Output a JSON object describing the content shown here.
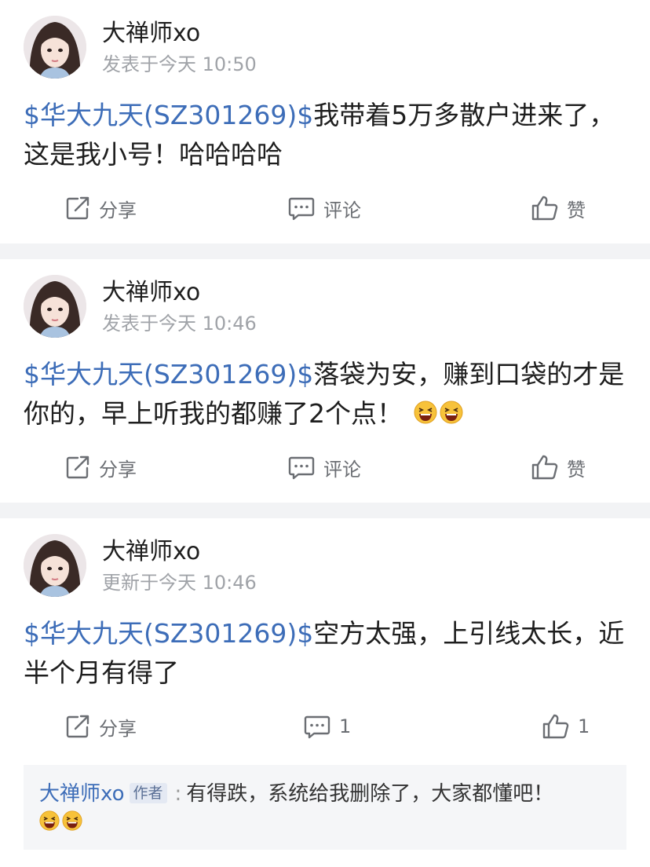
{
  "posts": [
    {
      "author": "大禅师xo",
      "meta": "发表于今天 10:50",
      "stock_tag": "$华大九天(SZ301269)$",
      "text_line1": "我带着5万多散户进来了，",
      "text_line2": "这是我小号！哈哈哈哈",
      "actions": {
        "share": "分享",
        "comment": "评论",
        "like": "赞"
      }
    },
    {
      "author": "大禅师xo",
      "meta": "发表于今天 10:46",
      "stock_tag": "$华大九天(SZ301269)$",
      "text_line1": "落袋为安，赚到口袋的才是",
      "text_line2": "你的，早上听我的都赚了2个点！",
      "emojis": [
        "grinning-squint-emoji",
        "grinning-squint-emoji"
      ],
      "actions": {
        "share": "分享",
        "comment": "评论",
        "like": "赞"
      }
    },
    {
      "author": "大禅师xo",
      "meta": "更新于今天 10:46",
      "stock_tag": "$华大九天(SZ301269)$",
      "text_line1": "空方太强，上引线太长，近",
      "text_line2": "半个月有得了",
      "actions": {
        "share": "分享",
        "comment": "1",
        "like": "1"
      },
      "reply": {
        "author": "大禅师xo",
        "author_tag": "作者",
        "separator": ":",
        "text": "有得跌，系统给我删除了，大家都懂吧！",
        "emojis": [
          "grinning-squint-emoji",
          "grinning-squint-emoji"
        ]
      }
    }
  ],
  "icons": {
    "share": "share-icon",
    "comment": "comment-icon",
    "like": "thumbs-up-icon"
  },
  "colors": {
    "stock_link": "#3d6db8",
    "meta_text": "#a0a3a8",
    "action_text": "#6b6e73",
    "separator_band": "#f2f3f5",
    "reply_background": "#f5f6f8"
  }
}
